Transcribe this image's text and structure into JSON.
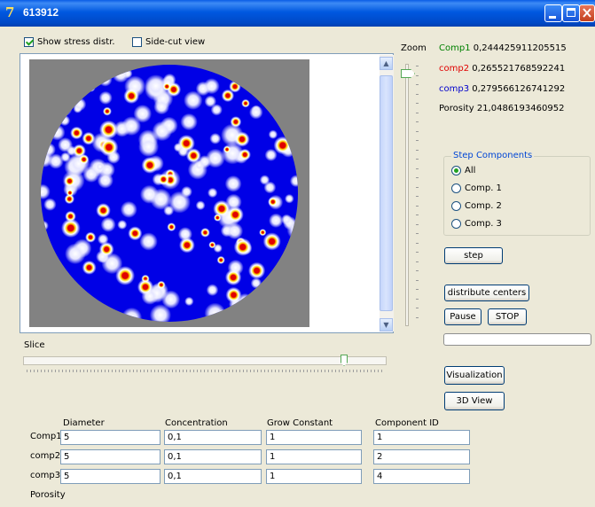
{
  "window": {
    "title": "613912"
  },
  "checkboxes": {
    "show_stress": {
      "label": "Show stress distr.",
      "checked": true
    },
    "side_cut": {
      "label": "Side-cut view",
      "checked": false
    }
  },
  "zoom": {
    "label": "Zoom",
    "level": 0.04
  },
  "readouts": [
    {
      "label": "Comp1",
      "value": "0,244425911205515",
      "color": "#008000"
    },
    {
      "label": "comp2",
      "value": "0,265521768592241",
      "color": "#E00000"
    },
    {
      "label": "comp3",
      "value": "0,279566126741292",
      "color": "#0000CC"
    }
  ],
  "porosity_readout": {
    "label": "Porosity",
    "value": "21,0486193460952"
  },
  "step_components": {
    "title": "Step Components",
    "options": [
      "All",
      "Comp. 1",
      "Comp. 2",
      "Comp. 3"
    ],
    "selected": "All"
  },
  "buttons": {
    "step": "step",
    "distribute": "distribute centers",
    "pause": "Pause",
    "stop": "STOP",
    "visualization": "Visualization",
    "view3d": "3D View"
  },
  "progress": 0,
  "slice": {
    "label": "Slice",
    "value": 0.88
  },
  "table": {
    "headers": [
      "Diameter",
      "Concentration",
      "Grow Constant",
      "Component ID"
    ],
    "rows": [
      {
        "label": "Comp1",
        "values": [
          "5",
          "0,1",
          "1",
          "1"
        ]
      },
      {
        "label": "comp2",
        "values": [
          "5",
          "0,1",
          "1",
          "2"
        ]
      },
      {
        "label": "comp3",
        "values": [
          "5",
          "0,1",
          "1",
          "4"
        ]
      }
    ],
    "footer_label": "Porosity"
  },
  "colors": {
    "pore_background": "#0000E6",
    "stress_high": "#E00000",
    "stress_mid": "#FFD500",
    "outside": "#828282"
  }
}
